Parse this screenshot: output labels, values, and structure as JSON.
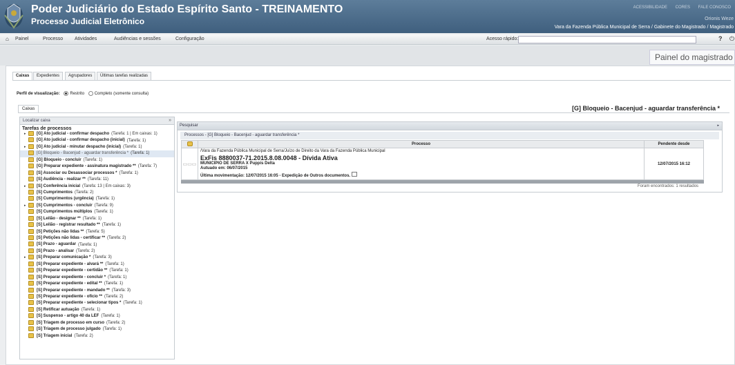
{
  "header": {
    "title": "Poder Judiciário do Estado Espírito Santo - TREINAMENTO",
    "subtitle": "Processo Judicial Eletrônico",
    "links": [
      "ACESSIBILIDADE",
      "CORES",
      "FALE CONOSCO"
    ],
    "user": "Orionis Weze",
    "unit": "Vara da Fazenda Pública Municipal de Serra / Gabinete do Magistrado / Magistrado"
  },
  "nav": {
    "home_icon": "home-icon",
    "items": [
      "Painel",
      "Processo",
      "Atividades",
      "Audiências e sessões",
      "Configuração"
    ],
    "quick_access_label": "Acesso rápido:",
    "quick_access_value": "",
    "help_icon": "help-icon",
    "power_icon": "power-icon"
  },
  "panel_title": "Painel do magistrado",
  "tabs": [
    "Caixas",
    "Expedientes",
    "Agrupadores",
    "Últimas tarefas realizadas"
  ],
  "profile": {
    "label": "Perfil de visualização:",
    "opt1": "Restrito",
    "opt2": "Completo (somente consulta)",
    "selected": "Restrito"
  },
  "subtab": "Caixas",
  "right_title": "[G] Bloqueio - Bacenjud - aguardar transferência *",
  "left_panel": {
    "head": "Localizar caixa",
    "close": "»",
    "root": "Tarefas de processos",
    "items": [
      {
        "arrow": "▸",
        "name": "[G] Ato judicial - confirmar despacho",
        "count": "(Tarefa: 1 | Em caixas: 1)"
      },
      {
        "arrow": "",
        "name": "[G] Ato judicial - confirmar despacho (inicial)",
        "count": "(Tarefa: 1)"
      },
      {
        "arrow": "▸",
        "name": "[G] Ato judicial - minutar despacho (inicial)",
        "count": "(Tarefa: 1)"
      },
      {
        "arrow": "",
        "name": "[G] Bloqueio - Bacenjud - aguardar transferência *",
        "count": "(Tarefa: 1)",
        "selected": true
      },
      {
        "arrow": "",
        "name": "[G] Bloqueio - concluir",
        "count": "(Tarefa: 1)"
      },
      {
        "arrow": "",
        "name": "[G] Preparar expediente - assinatura magistrado **",
        "count": "(Tarefa: 7)"
      },
      {
        "arrow": "",
        "name": "[S] Associar ou Desassociar processos *",
        "count": "(Tarefa: 1)"
      },
      {
        "arrow": "",
        "name": "[S] Audiência - realizar **",
        "count": "(Tarefa: 11)"
      },
      {
        "arrow": "▸",
        "name": "[S] Conferência inicial",
        "count": "(Tarefa: 13 | Em caixas: 3)"
      },
      {
        "arrow": "",
        "name": "[S] Cumprimentos",
        "count": "(Tarefa: 2)"
      },
      {
        "arrow": "",
        "name": "[S] Cumprimentos (urgência)",
        "count": "(Tarefa: 1)"
      },
      {
        "arrow": "▸",
        "name": "[S] Cumprimentos - concluir",
        "count": "(Tarefa: 9)"
      },
      {
        "arrow": "",
        "name": "[S] Cumprimentos múltiplos",
        "count": "(Tarefa: 1)"
      },
      {
        "arrow": "",
        "name": "[S] Leilão - designar **",
        "count": "(Tarefa: 1)"
      },
      {
        "arrow": "",
        "name": "[S] Leilão - registrar resultado **",
        "count": "(Tarefa: 1)"
      },
      {
        "arrow": "",
        "name": "[S] Petições não lidas **",
        "count": "(Tarefa: 5)"
      },
      {
        "arrow": "",
        "name": "[S] Petições não lidas - certificar **",
        "count": "(Tarefa: 2)"
      },
      {
        "arrow": "",
        "name": "[S] Prazo - aguardar",
        "count": "(Tarefa: 1)"
      },
      {
        "arrow": "",
        "name": "[S] Prazo - analisar",
        "count": "(Tarefa: 2)"
      },
      {
        "arrow": "▸",
        "name": "[S] Preparar comunicação *",
        "count": "(Tarefa: 3)"
      },
      {
        "arrow": "",
        "name": "[S] Preparar expediente - alvará **",
        "count": "(Tarefa: 1)"
      },
      {
        "arrow": "",
        "name": "[S] Preparar expediente - certidão **",
        "count": "(Tarefa: 1)"
      },
      {
        "arrow": "",
        "name": "[S] Preparar expediente - concluir *",
        "count": "(Tarefa: 1)"
      },
      {
        "arrow": "",
        "name": "[S] Preparar expediente - edital **",
        "count": "(Tarefa: 1)"
      },
      {
        "arrow": "",
        "name": "[S] Preparar expediente - mandado **",
        "count": "(Tarefa: 3)"
      },
      {
        "arrow": "",
        "name": "[S] Preparar expediente - ofício **",
        "count": "(Tarefa: 2)"
      },
      {
        "arrow": "",
        "name": "[S] Preparar expediente - selecionar tipos *",
        "count": "(Tarefa: 1)"
      },
      {
        "arrow": "",
        "name": "[S] Retificar autuação",
        "count": "(Tarefa: 1)"
      },
      {
        "arrow": "",
        "name": "[S] Suspenso - artigo 40 da LEF",
        "count": "(Tarefa: 1)"
      },
      {
        "arrow": "",
        "name": "[S] Triagem de processo em curso",
        "count": "(Tarefa: 2)"
      },
      {
        "arrow": "",
        "name": "[S] Triagem de processo julgado",
        "count": "(Tarefa: 1)"
      },
      {
        "arrow": "",
        "name": "[S] Triagem inicial",
        "count": "(Tarefa: 2)"
      }
    ]
  },
  "search": {
    "head": "Pesquisar",
    "sub": "Processos - [G] Bloqueio - Bacenjud - aguardar transferência *",
    "col_process": "Processo",
    "col_pending": "Pendente desde",
    "row": {
      "vara": "/Vara da Fazenda Pública Municipal de Serra/Juízo de Direito da Vara da Fazenda Pública Municipal",
      "number": "ExFis 8880037-71.2015.8.08.0048 - Dívida Ativa",
      "parties": "MUNICIPIO DE SERRA X Puppis Delta",
      "autuado": "Autuado em: 06/07/2015",
      "movement": "Última movimentação: 12/07/2015 16:05 - Expedição de Outros documentos.",
      "pending": "12/07/2015 16:12"
    },
    "found": "Foram encontrados: 1 resultados"
  }
}
